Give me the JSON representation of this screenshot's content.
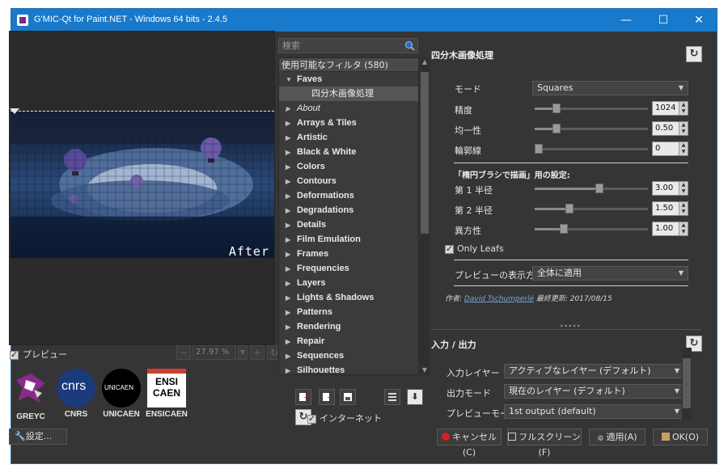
{
  "window": {
    "title": "G'MIC-Qt for Paint.NET - Windows 64 bits - 2.4.5",
    "minimize": "—",
    "maximize": "☐",
    "close": "✕"
  },
  "preview": {
    "after_label": "After",
    "checkbox_label": "プレビュー",
    "zoom_value": "27.97 %"
  },
  "logos": [
    {
      "name": "GREYC",
      "caption": "GREYC"
    },
    {
      "name": "CNRS",
      "caption": "CNRS",
      "text": "cnrs"
    },
    {
      "name": "UNICAEN",
      "caption": "UNICAEN",
      "text": "UNICAEN"
    },
    {
      "name": "ENSICAEN",
      "caption": "ENSICAEN",
      "text": "ENSI CAEN"
    }
  ],
  "settings_button": "🔧設定...",
  "filters": {
    "search_placeholder": "検索",
    "header": "使用可能なフィルタ (580)",
    "items": [
      {
        "label": "Faves",
        "expanded": true
      },
      {
        "label": "四分木画像処理",
        "sub": true
      },
      {
        "label": "About",
        "italic": true
      },
      {
        "label": "Arrays & Tiles"
      },
      {
        "label": "Artistic"
      },
      {
        "label": "Black & White"
      },
      {
        "label": "Colors"
      },
      {
        "label": "Contours"
      },
      {
        "label": "Deformations"
      },
      {
        "label": "Degradations"
      },
      {
        "label": "Details"
      },
      {
        "label": "Film Emulation"
      },
      {
        "label": "Frames"
      },
      {
        "label": "Frequencies"
      },
      {
        "label": "Layers"
      },
      {
        "label": "Lights & Shadows"
      },
      {
        "label": "Patterns"
      },
      {
        "label": "Rendering"
      },
      {
        "label": "Repair"
      },
      {
        "label": "Sequences"
      },
      {
        "label": "Silhouettes"
      }
    ],
    "internet_label": "インターネット"
  },
  "filter_params": {
    "title": "四分木画像処理",
    "mode_label": "モード",
    "mode_value": "Squares",
    "precision_label": "精度",
    "precision_value": "1024",
    "precision_level": 0.17,
    "homogeneity_label": "均一性",
    "homogeneity_value": "0.50",
    "homogeneity_level": 0.17,
    "outline_label": "輪郭線",
    "outline_value": "0",
    "outline_level": 0.0,
    "ellipse_section": "「楕円ブラシで描画」用の設定:",
    "radius1_label": "第 1 半径",
    "radius1_value": "3.00",
    "radius1_level": 0.58,
    "radius2_label": "第 2 半径",
    "radius2_value": "1.50",
    "radius2_level": 0.29,
    "anisotropy_label": "異方性",
    "anisotropy_value": "1.00",
    "anisotropy_level": 0.24,
    "only_leafs_label": "Only Leafs",
    "preview_method_label": "プレビューの表示方法",
    "preview_method_value": "全体に適用",
    "author_prefix": "作者:",
    "author_name": "David Tschumperlé",
    "updated_label": "最終更新:",
    "updated_date": "2017/08/15"
  },
  "io": {
    "title": "入力 / 出力",
    "input_label": "入力レイヤー",
    "input_value": "アクティブなレイヤー (デフォルト)",
    "output_label": "出力モード",
    "output_value": "現在のレイヤー (デフォルト)",
    "preview_mode_label": "プレビューモード",
    "preview_mode_value": "1st output (default)"
  },
  "buttons": {
    "cancel": "キャンセル(C)",
    "fullscreen": "フルスクリーン(F)",
    "apply": "適用(A)",
    "ok": "OK(O)"
  },
  "colors": {
    "titlebar": "#1979ca",
    "background": "#353535",
    "cancel_icon": "#d42020"
  }
}
